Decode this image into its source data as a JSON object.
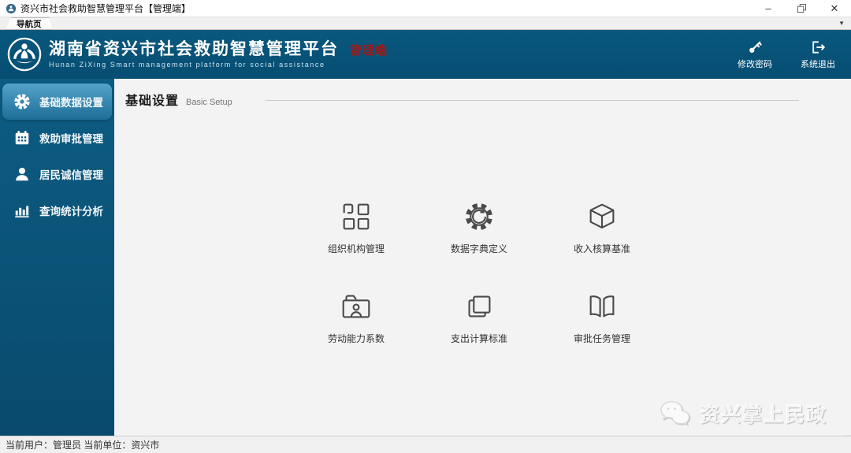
{
  "window": {
    "title": "资兴市社会救助智慧管理平台【管理端】",
    "minimize_glyph": "–",
    "close_glyph": "✕"
  },
  "tab_bar": {
    "active_tab": "导航页",
    "overflow_caret": "▼"
  },
  "header": {
    "title": "湖南省资兴市社会救助智慧管理平台",
    "subtitle": "Hunan ZiXing Smart management platform for social assistance",
    "badge": "管理端",
    "change_password": "修改密码",
    "logout": "系统退出"
  },
  "sidebar": {
    "items": [
      {
        "label": "基础数据设置",
        "icon": "gear-icon",
        "active": true
      },
      {
        "label": "救助审批管理",
        "icon": "calendar-icon",
        "active": false
      },
      {
        "label": "居民诚信管理",
        "icon": "person-icon",
        "active": false
      },
      {
        "label": "查询统计分析",
        "icon": "bar-chart-icon",
        "active": false
      }
    ]
  },
  "main": {
    "section_title": "基础设置",
    "section_subtitle": "Basic Setup",
    "items": [
      {
        "label": "组织机构管理",
        "icon": "grid-squares-icon"
      },
      {
        "label": "数据字典定义",
        "icon": "gear-sync-icon"
      },
      {
        "label": "收入核算基准",
        "icon": "cube-icon"
      },
      {
        "label": "劳动能力系数",
        "icon": "folder-person-icon"
      },
      {
        "label": "支出计算标准",
        "icon": "overlap-squares-icon"
      },
      {
        "label": "审批任务管理",
        "icon": "open-book-icon"
      }
    ]
  },
  "watermark": {
    "label": "资兴掌上民政"
  },
  "status_bar": {
    "text": "当前用户：管理员 当前单位：资兴市"
  },
  "colors": {
    "header_bg": "#075378",
    "sidebar_bg": "#0a547a",
    "active_item_top": "#54a3ca",
    "active_item_bottom": "#1d6d97",
    "badge_red": "#9e1b1b",
    "main_bg": "#f3f3f3",
    "icon_stroke": "#4a4a4a"
  }
}
